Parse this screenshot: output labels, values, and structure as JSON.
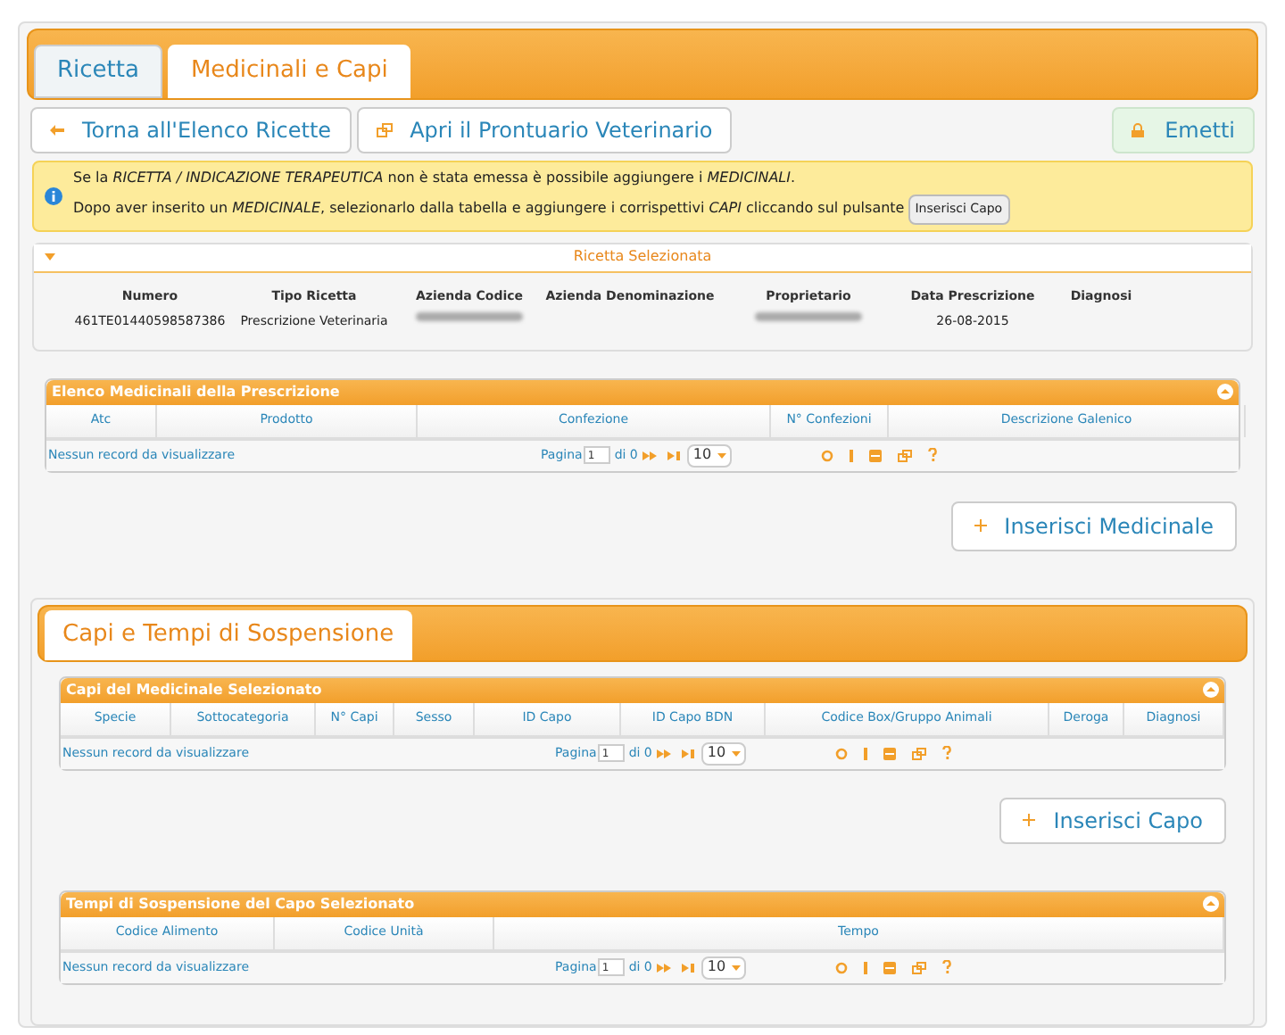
{
  "tabs": [
    {
      "label": "Ricetta",
      "selected": false
    },
    {
      "label": "Medicinali e Capi",
      "selected": true
    }
  ],
  "toolbar": {
    "buttons": [
      {
        "label": "Torna all'Elenco Ricette",
        "kind": "back"
      },
      {
        "label": "Apri il Prontuario Veterinario",
        "kind": "open"
      }
    ],
    "emit_button": {
      "label": "Emetti"
    }
  },
  "info": {
    "line_1": "Se la *RICETTA / INDICAZIONE TERAPEUTICA* non è stata emessa è possibile aggiungere i *MEDICINALI*.",
    "line_2": "Dopo aver inserito un *MEDICINALE*, selezionarlo dalla tabella e aggiungere i corrispettivi *CAPI* cliccando sul pulsante",
    "inline_button": "Inserisci Capo"
  },
  "selected_prescription": {
    "title": "Ricetta Selezionata",
    "expanded": true,
    "fields": [
      {
        "label": "Numero",
        "value": "461TE01440598587386"
      },
      {
        "label": "Tipo Ricetta",
        "value": "Prescrizione Veterinaria"
      },
      {
        "label": "Azienda Codice",
        "redacted": true
      },
      {
        "label": "Azienda Denominazione"
      },
      {
        "label": "Proprietario",
        "redacted": true
      },
      {
        "label": "Data Prescrizione",
        "value": "26-08-2015"
      },
      {
        "label": "Diagnosi"
      }
    ]
  },
  "medicines_grid": {
    "title": "Elenco Medicinali della Prescrizione",
    "columns": [
      "Atc",
      "Prodotto",
      "Confezione",
      "N° Confezioni",
      "Descrizione Galenico"
    ],
    "empty_text": "Nessun record da visualizzare",
    "pager": {
      "page_label": "Pagina",
      "page": "1",
      "of": "di 0",
      "page_size": "10"
    }
  },
  "add_medicine_button": "Inserisci Medicinale",
  "section_tab": {
    "label": "Capi e Tempi di Sospensione",
    "selected": true
  },
  "animals_grid": {
    "title": "Capi del Medicinale Selezionato",
    "columns": [
      "Specie",
      "Sottocategoria",
      "N° Capi",
      "Sesso",
      "ID Capo",
      "ID Capo BDN",
      "Codice Box/Gruppo Animali",
      "Deroga",
      "Diagnosi"
    ],
    "empty_text": "Nessun record da visualizzare",
    "pager": {
      "page_label": "Pagina",
      "page": "1",
      "of": "di 0",
      "page_size": "10"
    }
  },
  "add_animal_button": "Inserisci Capo",
  "withdrawal_grid": {
    "title": "Tempi di Sospensione del Capo Selezionato",
    "columns": [
      "Codice Alimento",
      "Codice Unità",
      "Tempo"
    ],
    "empty_text": "Nessun record da visualizzare",
    "pager": {
      "page_label": "Pagina",
      "page": "1",
      "of": "di 0",
      "page_size": "10"
    }
  }
}
